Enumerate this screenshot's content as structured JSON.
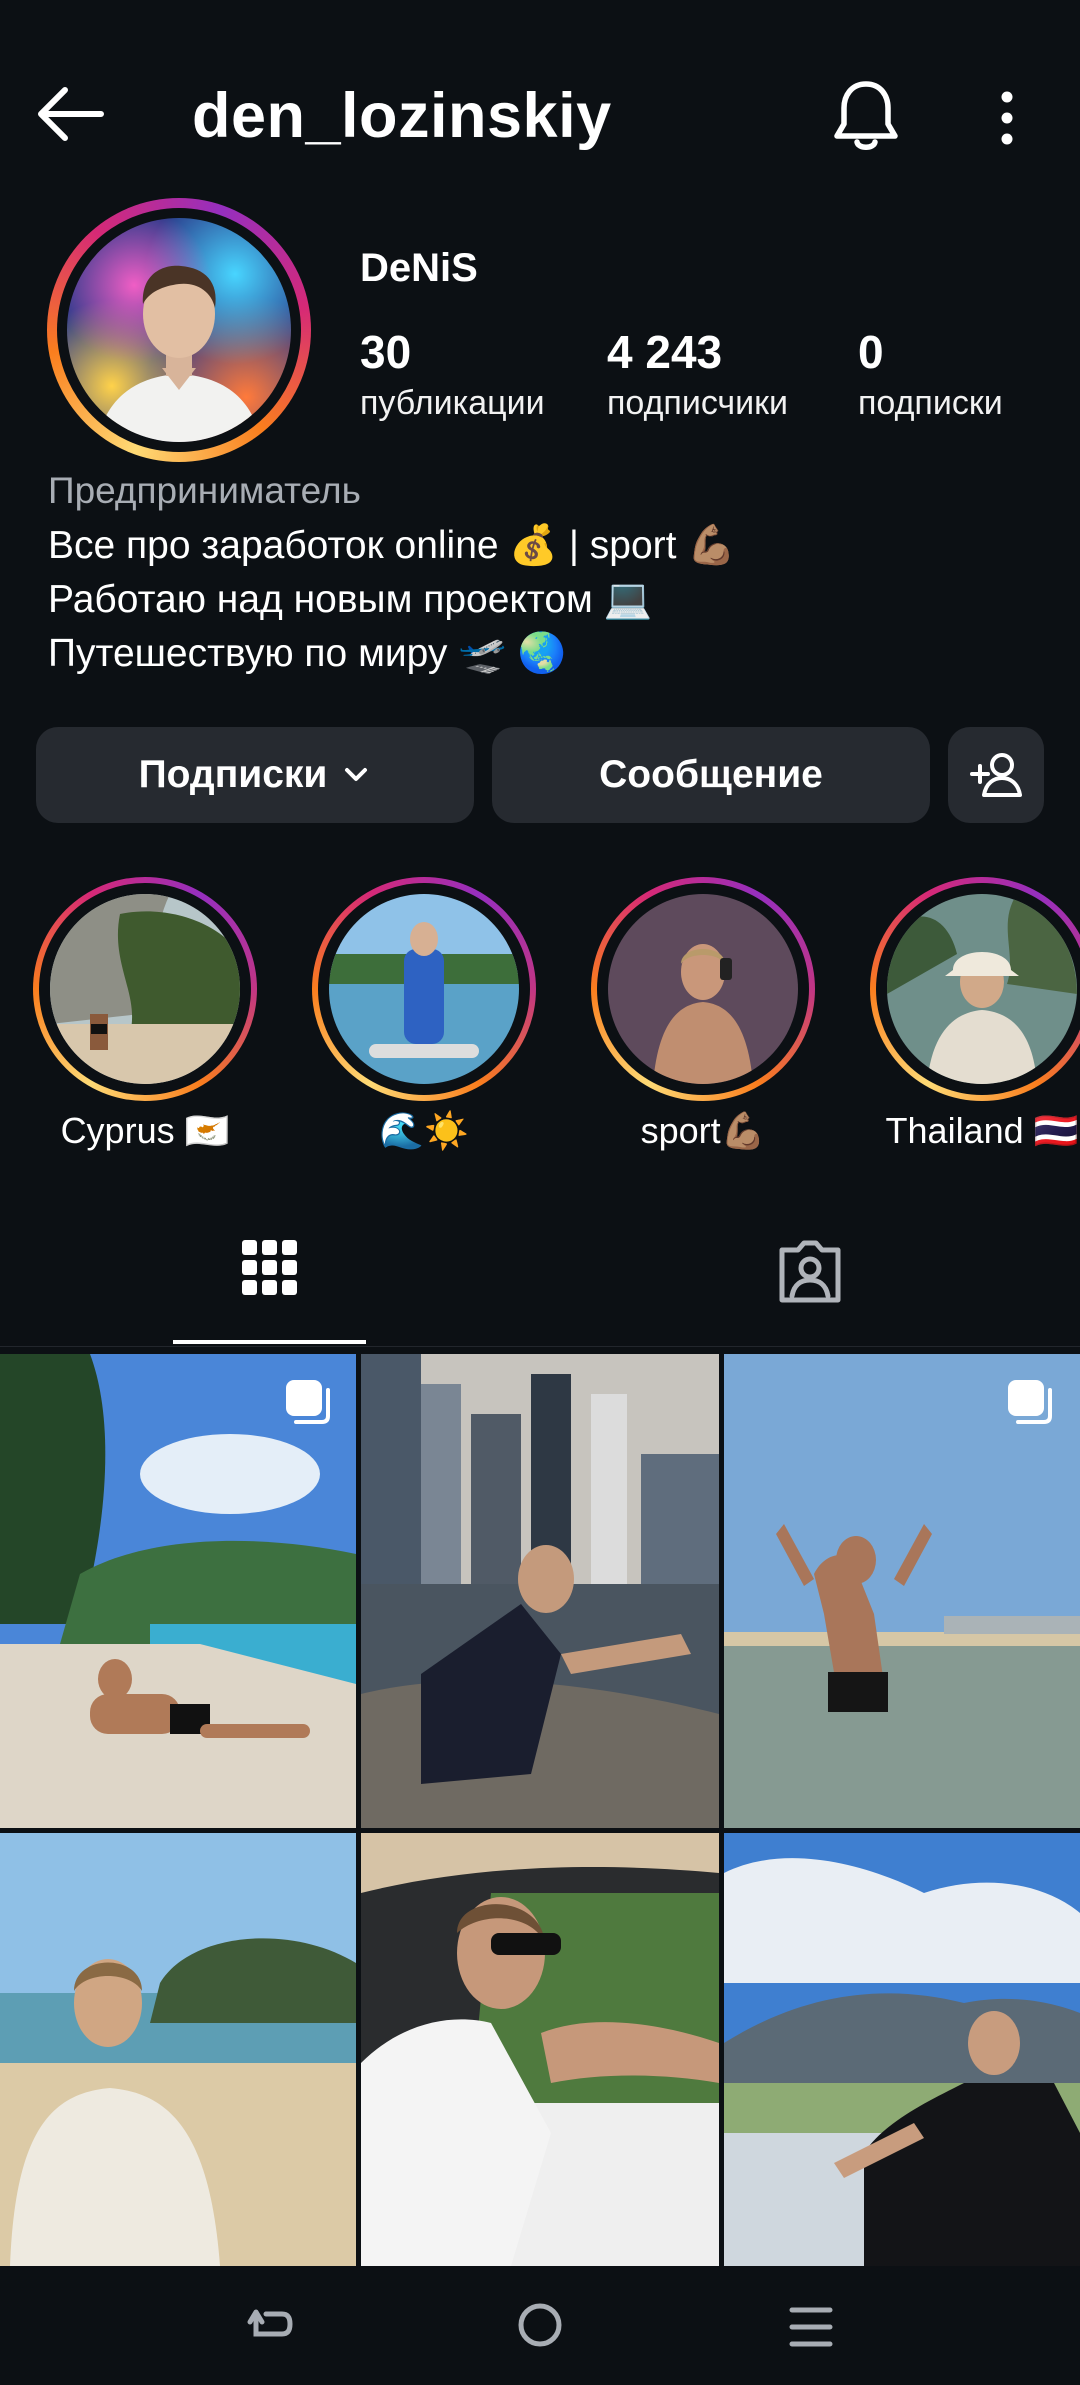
{
  "header": {
    "username": "den_lozinskiy",
    "icons": {
      "back": "arrow-left-icon",
      "notifications": "bell-icon",
      "more": "more-vertical-icon"
    }
  },
  "profile": {
    "display_name": "DeNiS",
    "stats": [
      {
        "value": "30",
        "label": "публикации"
      },
      {
        "value": "4 243",
        "label": "подписчики"
      },
      {
        "value": "0",
        "label": "подписки"
      }
    ],
    "category": "Предприниматель",
    "bio_lines": [
      "Все про заработок online 💰 | sport 💪🏽",
      "Работаю над новым проектом 💻",
      "Путешествую по миру 🛫 🌏"
    ]
  },
  "actions": {
    "following_label": "Подписки",
    "message_label": "Сообщение",
    "icons": {
      "dropdown": "chevron-down-icon",
      "add_user": "add-person-icon"
    }
  },
  "highlights": [
    {
      "label": "Cyprus 🇨🇾"
    },
    {
      "label": "🌊☀️"
    },
    {
      "label": "sport💪🏽"
    },
    {
      "label": "Thailand 🇹🇭"
    }
  ],
  "tabs": {
    "icons": {
      "grid": "grid-icon",
      "tagged": "tagged-person-icon"
    }
  },
  "grid": {
    "posts": [
      {
        "scene": "beach-forest",
        "multi_photo": true
      },
      {
        "scene": "city-boat",
        "multi_photo": false
      },
      {
        "scene": "sea-back",
        "multi_photo": true
      },
      {
        "scene": "beach-shirt",
        "multi_photo": false
      },
      {
        "scene": "car-driver",
        "multi_photo": false
      },
      {
        "scene": "yacht-mountains",
        "multi_photo": false
      }
    ],
    "icons": {
      "multi_photo": "multiple-photos-icon"
    }
  },
  "navbar": {
    "icons": {
      "back": "nav-back-icon",
      "home": "nav-home-icon",
      "recents": "nav-recents-icon"
    }
  },
  "colors": {
    "background": "#0c1014",
    "button": "#262a30",
    "muted_text": "#a8adb4"
  }
}
